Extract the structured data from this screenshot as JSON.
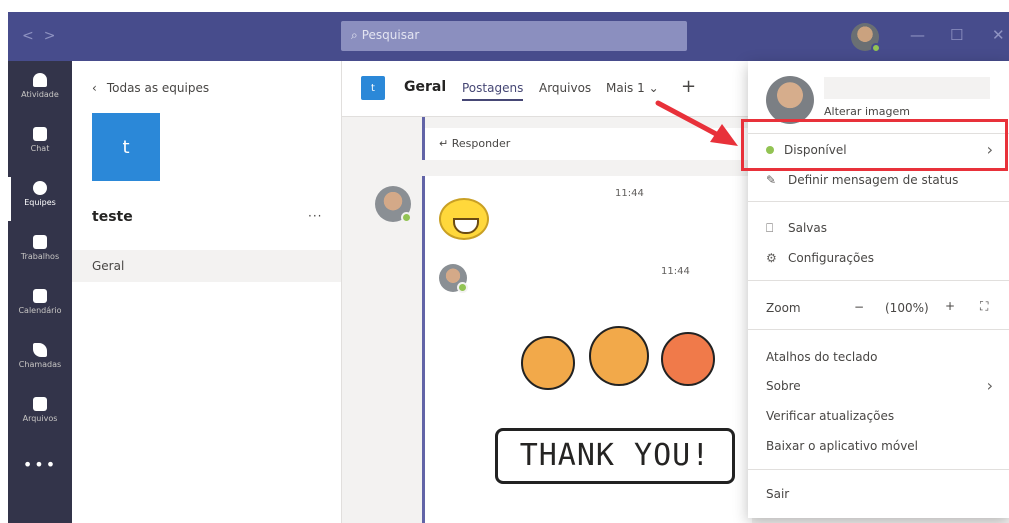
{
  "titlebar": {
    "search_placeholder": "Pesquisar",
    "nav_back": "<",
    "nav_forward": ">",
    "minimize": "—",
    "maximize": "☐",
    "close": "✕"
  },
  "rail": {
    "items": [
      {
        "label": "Atividade",
        "icon": "bell-icon"
      },
      {
        "label": "Chat",
        "icon": "chat-icon"
      },
      {
        "label": "Equipes",
        "icon": "teams-icon",
        "active": true
      },
      {
        "label": "Trabalhos",
        "icon": "assignments-icon"
      },
      {
        "label": "Calendário",
        "icon": "calendar-icon"
      },
      {
        "label": "Chamadas",
        "icon": "phone-icon"
      },
      {
        "label": "Arquivos",
        "icon": "files-icon"
      }
    ],
    "more": "•••"
  },
  "teampanel": {
    "back_label": "Todas as equipes",
    "team_initial": "t",
    "team_name": "teste",
    "more": "···",
    "channel": "Geral"
  },
  "main": {
    "channel_initial": "t",
    "channel_name": "Geral",
    "tabs": [
      "Postagens",
      "Arquivos",
      "Mais 1"
    ],
    "add_tab": "+",
    "reply_label": "Responder",
    "messages": [
      {
        "time": "11:44",
        "content": "grinning-emoji"
      },
      {
        "time": "11:44",
        "sticker_text": "THANK YOU!"
      }
    ]
  },
  "menu": {
    "change_image": "Alterar imagem",
    "status": "Disponível",
    "set_status": "Definir mensagem de status",
    "saved": "Salvas",
    "settings": "Configurações",
    "zoom_label": "Zoom",
    "zoom_minus": "−",
    "zoom_value": "(100%)",
    "zoom_plus": "+",
    "shortcuts": "Atalhos do teclado",
    "about": "Sobre",
    "check_updates": "Verificar atualizações",
    "download_mobile": "Baixar o aplicativo móvel",
    "sign_out": "Sair"
  },
  "colors": {
    "titlebar": "#474c8c",
    "rail": "#33344a",
    "accent": "#6264a7",
    "available": "#92c353",
    "highlight": "#e8313a"
  }
}
